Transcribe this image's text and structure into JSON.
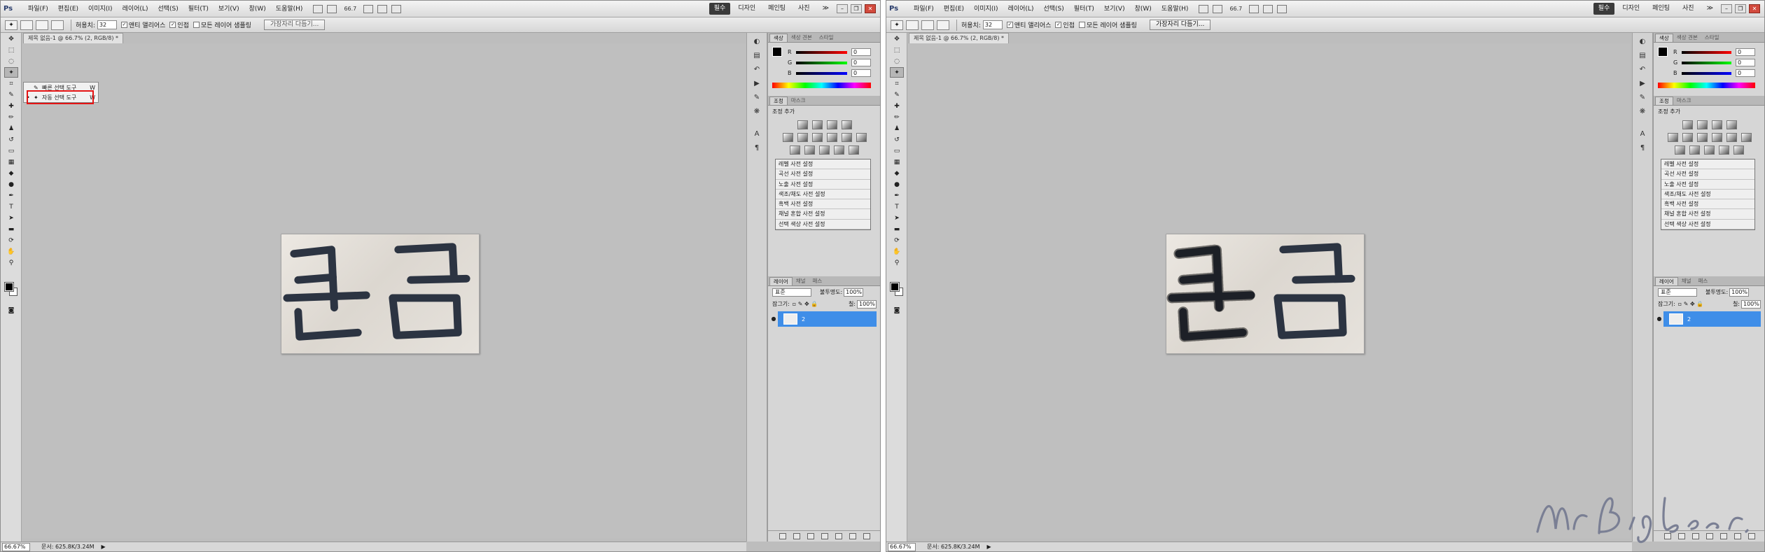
{
  "menu": {
    "logo": "Ps",
    "items": [
      "파일(F)",
      "편집(E)",
      "이미지(I)",
      "레이어(L)",
      "선택(S)",
      "필터(T)",
      "보기(V)",
      "창(W)",
      "도움말(H)"
    ],
    "zoom": "66.7"
  },
  "workspace": {
    "active": "필수",
    "items": [
      "필수",
      "디자인",
      "페인팅",
      "사진"
    ],
    "more": "≫",
    "minimize": "–",
    "restore": "❐",
    "close": "✕"
  },
  "options": {
    "tolerance_label": "허용치:",
    "tolerance_value": "32",
    "antialias_label": "앤티 앨리어스",
    "contiguous_label": "인접",
    "sample_all_label": "모든 레이어 샘플링",
    "refine_button": "가장자리 다듬기..."
  },
  "document": {
    "tab": "제목 없음-1 @ 66.7% (2, RGB/8) *",
    "zoom": "66.67%",
    "doc_size": "문서: 625.8K/3.24M",
    "status_arrow": "▶"
  },
  "tool_flyout": {
    "items": [
      {
        "label": "빠른 선택 도구",
        "key": "W",
        "icon": "quick-selection-icon",
        "active": false
      },
      {
        "label": "자동 선택 도구",
        "key": "W",
        "icon": "magic-wand-icon",
        "active": true
      }
    ]
  },
  "canvas_image": {
    "text": "큰곰",
    "ink_color": "#2c3442"
  },
  "color_panel": {
    "tabs": [
      "색상",
      "색상 견본",
      "스타일"
    ],
    "channels": [
      {
        "label": "R",
        "value": "0",
        "color": "#e02020"
      },
      {
        "label": "G",
        "value": "0",
        "color": "#20b020"
      },
      {
        "label": "B",
        "value": "0",
        "color": "#2040e0"
      }
    ]
  },
  "adjust_panel": {
    "tabs": [
      "조정",
      "마스크"
    ],
    "title": "조정 추가",
    "presets": [
      "레벨 사전 설정",
      "곡선 사전 설정",
      "노출 사전 설정",
      "색조/채도 사전 설정",
      "흑백 사전 설정",
      "채널 혼합 사전 설정",
      "선택 색상 사전 설정"
    ]
  },
  "layers_panel": {
    "tabs": [
      "레이어",
      "채널",
      "패스"
    ],
    "blend_mode": "표준",
    "opacity_label": "불투명도:",
    "opacity_value": "100%",
    "lock_label": "잠그기:",
    "fill_label": "칠:",
    "fill_value": "100%",
    "layer_name": "2"
  },
  "watermark": {
    "text": "Mr. Big bear."
  }
}
